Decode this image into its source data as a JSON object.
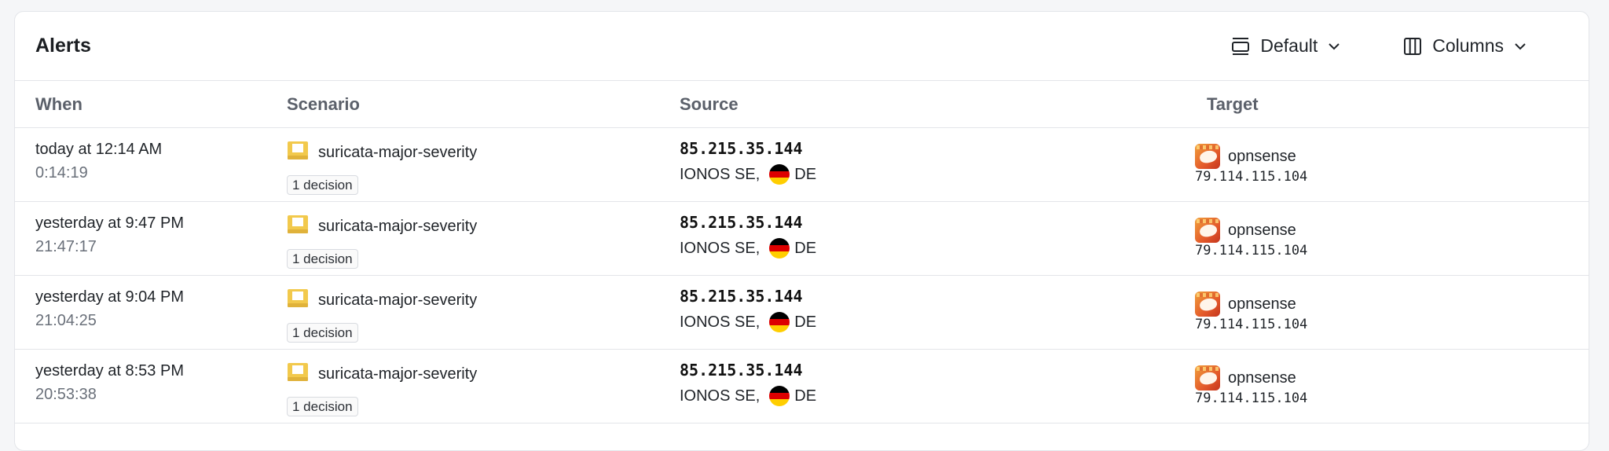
{
  "header": {
    "title": "Alerts",
    "view_label": "Default",
    "columns_label": "Columns"
  },
  "columns": {
    "when": "When",
    "scenario": "Scenario",
    "source": "Source",
    "target": "Target"
  },
  "icons": {
    "view": "layout-icon",
    "columns": "columns-icon",
    "chevron": "chevron-down-icon",
    "scenario": "suricata-icon",
    "flag": "germany-flag-icon",
    "target": "opnsense-icon"
  },
  "flag_colors": [
    "#000000",
    "#dd0000",
    "#ffce00"
  ],
  "rows": [
    {
      "when_relative": "today at 12:14 AM",
      "when_time": "0:14:19",
      "scenario": "suricata-major-severity",
      "decisions": "1 decision",
      "source_ip": "85.215.35.144",
      "source_org": "IONOS SE,",
      "source_country": "DE",
      "target_name": "opnsense",
      "target_ip": "79.114.115.104"
    },
    {
      "when_relative": "yesterday at 9:47 PM",
      "when_time": "21:47:17",
      "scenario": "suricata-major-severity",
      "decisions": "1 decision",
      "source_ip": "85.215.35.144",
      "source_org": "IONOS SE,",
      "source_country": "DE",
      "target_name": "opnsense",
      "target_ip": "79.114.115.104"
    },
    {
      "when_relative": "yesterday at 9:04 PM",
      "when_time": "21:04:25",
      "scenario": "suricata-major-severity",
      "decisions": "1 decision",
      "source_ip": "85.215.35.144",
      "source_org": "IONOS SE,",
      "source_country": "DE",
      "target_name": "opnsense",
      "target_ip": "79.114.115.104"
    },
    {
      "when_relative": "yesterday at 8:53 PM",
      "when_time": "20:53:38",
      "scenario": "suricata-major-severity",
      "decisions": "1 decision",
      "source_ip": "85.215.35.144",
      "source_org": "IONOS SE,",
      "source_country": "DE",
      "target_name": "opnsense",
      "target_ip": "79.114.115.104"
    }
  ]
}
